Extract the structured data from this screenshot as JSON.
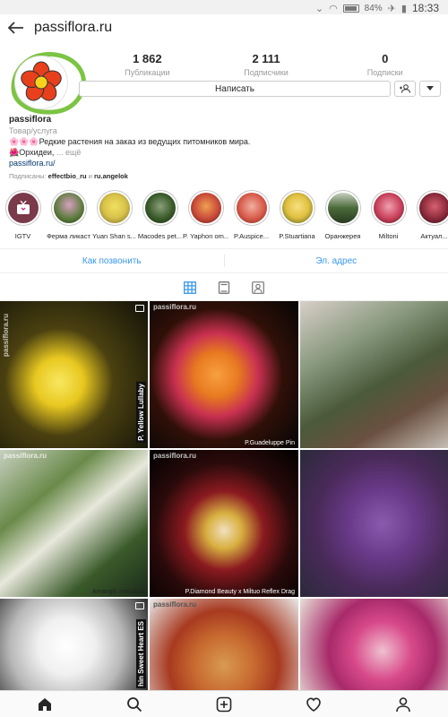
{
  "status_bar": {
    "battery": "84%",
    "time": "18:33"
  },
  "header": {
    "title": "passiflora.ru"
  },
  "stats": [
    {
      "value": "1 862",
      "label": "Публикации"
    },
    {
      "value": "2 111",
      "label": "Подписчики"
    },
    {
      "value": "0",
      "label": "Подписки"
    }
  ],
  "buttons": {
    "message": "Написать"
  },
  "bio": {
    "username": "passiflora",
    "category": "Товар/услуга",
    "line1": "🌸🌸🌸Редкие растения на заказ из ведущих питомников мира.",
    "line2": "🌺Орхидеи,",
    "more": "... ещё",
    "link": "passiflora.ru/",
    "followed_by_prefix": "Подписаны:",
    "followed_by_1": "effectbio_ru",
    "followed_by_and": "и",
    "followed_by_2": "ru.angelok"
  },
  "stories": [
    {
      "label": "IGTV",
      "color": "#7a3a4a"
    },
    {
      "label": "Ферма ликаст",
      "color": "#5a7a3a"
    },
    {
      "label": "Yuan Shan s...",
      "color": "#d8c24a"
    },
    {
      "label": "Macodes pet...",
      "color": "#3a5a2a"
    },
    {
      "label": "P. Yaphon om...",
      "color": "#c84a3a"
    },
    {
      "label": "P.Auspice...",
      "color": "#d85a4a"
    },
    {
      "label": "P.Stuartiana",
      "color": "#e0c040"
    },
    {
      "label": "Оранжерея",
      "color": "#4a6a3a"
    },
    {
      "label": "Miltoni",
      "color": "#c8405a"
    },
    {
      "label": "Актуал...",
      "color": "#8a2a3a"
    }
  ],
  "actions": {
    "call": "Как позвонить",
    "email": "Эл. адрес"
  },
  "grid": [
    {
      "bg": "linear-gradient(135deg,#1a1a0a 0%,#3a3a10 30%,#e8c820 55%,#2a2a10 100%)",
      "watermark": "passiflora.ru",
      "side": "P. Yellow Lullaby",
      "caption": "",
      "video": true
    },
    {
      "bg": "linear-gradient(160deg,#050505 0%,#7a3010 35%,#e87a20 55%,#c83050 70%,#101010 100%)",
      "watermark": "passiflora.ru",
      "side": "",
      "caption": "P.Guadeluppe Pin",
      "video": false
    },
    {
      "bg": "linear-gradient(150deg,#d8cfc8 0%,#7a8a70 40%,#4a5a3a 60%,#c8c0b8 100%)",
      "watermark": "",
      "side": "",
      "caption": "",
      "video": false
    },
    {
      "bg": "linear-gradient(140deg,#c8d0c0 0%,#6a8a4a 35%,#f0f0e8 55%,#3a5a2a 80%,#1a2a1a 100%)",
      "watermark": "passiflora.ru",
      "side": "",
      "caption": "Aerangis articulata",
      "video": false
    },
    {
      "bg": "radial-gradient(circle at 50% 55%,#f0e0c0 0%,#d8b040 18%,#8a1a20 38%,#2a0a0a 65%,#000 100%)",
      "watermark": "passiflora.ru",
      "side": "",
      "caption": "P.Diamond Beauty x Miltuo Reflex Drag",
      "video": false
    },
    {
      "bg": "linear-gradient(150deg,#2a2a3a 0%,#6a3a8a 35%,#5a2a7a 55%,#8a7aaa 80%,#3a2a4a 100%)",
      "watermark": "",
      "side": "",
      "caption": "",
      "video": false
    },
    {
      "bg": "linear-gradient(140deg,#2a2a2a 0%,#e8e8e8 35%,#ffffff 55%,#c8c8c8 80%,#3a3a3a 100%)",
      "watermark": "",
      "side": "hin Sweet Heart ES",
      "caption": "",
      "video": true
    },
    {
      "bg": "linear-gradient(170deg,#e8e8e8 0%,#c86a30 35%,#a83a20 60%,#d89a50 100%)",
      "watermark": "passiflora.ru",
      "side": "",
      "caption": "",
      "video": false
    },
    {
      "bg": "linear-gradient(150deg,#e8e0d8 0%,#d84a8a 40%,#a82a6a 60%,#f0c0d0 100%)",
      "watermark": "",
      "side": "",
      "caption": "",
      "video": false
    }
  ]
}
